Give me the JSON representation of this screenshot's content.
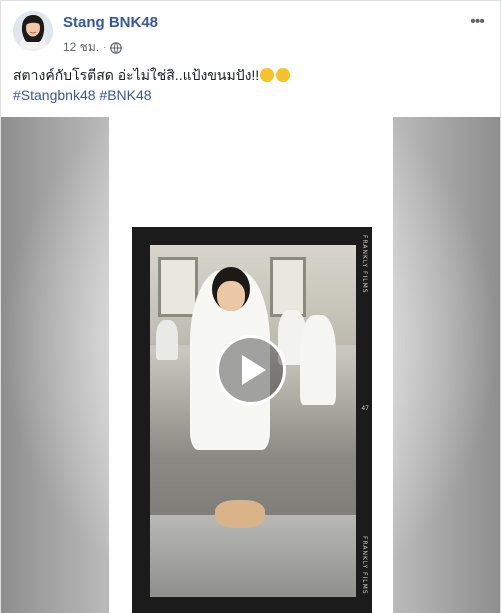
{
  "post": {
    "author": "Stang BNK48",
    "time": "12 ชม.",
    "separator": "·",
    "more_icon": "more-horizontal-icon",
    "text": "สตางค์กับโรตีสด อ่ะไม่ใช่สิ..แป้งขนมปัง!!",
    "hashtags": [
      "#Stangbnk48",
      "#BNK48"
    ]
  },
  "video": {
    "overlay_top": "FRANKLY FILMS",
    "overlay_bottom": "FRANKLY FILMS",
    "frame_number": "47"
  },
  "colors": {
    "link": "#385898",
    "meta": "#616770",
    "emoji": "#f7c12b"
  }
}
